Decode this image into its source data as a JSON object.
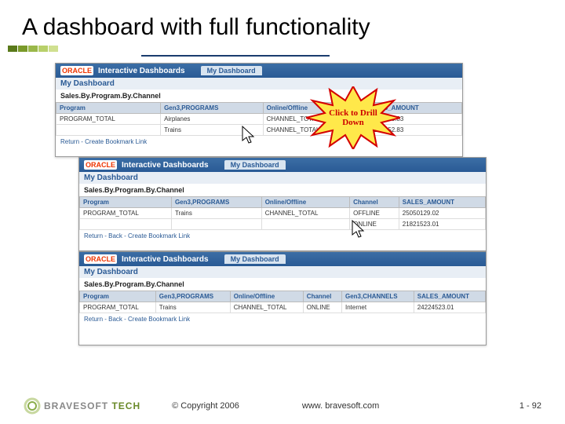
{
  "title": "A dashboard with full functionality",
  "oracle": "ORACLE",
  "product": "Interactive Dashboards",
  "tab": "My Dashboard",
  "myDash": "My Dashboard",
  "section": "Sales.By.Program.By.Channel",
  "callout": {
    "l1": "Click to Drill",
    "l2": "Down"
  },
  "s1": {
    "h": {
      "c1": "Program",
      "c2": "Gen3,PROGRAMS",
      "c3": "Online/Offline",
      "c4": "SALES_AMOUNT"
    },
    "r1": {
      "c1": "PROGRAM_TOTAL",
      "c2": "Airplanes",
      "c3": "CHANNEL_TOTAL",
      "c4": "17829740.83"
    },
    "r2": {
      "c1": "",
      "c2": "Trains",
      "c3": "CHANNEL_TOTAL",
      "c4": "20227652.83"
    },
    "links": "Return - Create Bookmark Link"
  },
  "s2": {
    "h": {
      "c1": "Program",
      "c2": "Gen3,PROGRAMS",
      "c3": "Online/Offline",
      "c4": "Channel",
      "c5": "SALES_AMOUNT"
    },
    "r1": {
      "c1": "PROGRAM_TOTAL",
      "c2": "Trains",
      "c3": "CHANNEL_TOTAL",
      "c4": "OFFLINE",
      "c5": "25050129.02"
    },
    "r2": {
      "c1": "",
      "c2": "",
      "c3": "",
      "c4": "ONLINE",
      "c5": "21821523.01"
    },
    "links": "Return - Back - Create Bookmark Link"
  },
  "s3": {
    "section": "Sales.By.Program.By.Channel",
    "h": {
      "c1": "Program",
      "c2": "Gen3,PROGRAMS",
      "c3": "Online/Offline",
      "c4": "Channel",
      "c5": "Gen3,CHANNELS",
      "c6": "SALES_AMOUNT"
    },
    "r1": {
      "c1": "PROGRAM_TOTAL",
      "c2": "Trains",
      "c3": "CHANNEL_TOTAL",
      "c4": "ONLINE",
      "c5": "Internet",
      "c6": "24224523.01"
    },
    "links": "Return - Back - Create Bookmark Link"
  },
  "footer": {
    "brand1": "BRAVESOFT",
    "brand2": "TECH",
    "copyright": "© Copyright 2006",
    "url": "www. bravesoft.com",
    "page": "1 - 92"
  }
}
